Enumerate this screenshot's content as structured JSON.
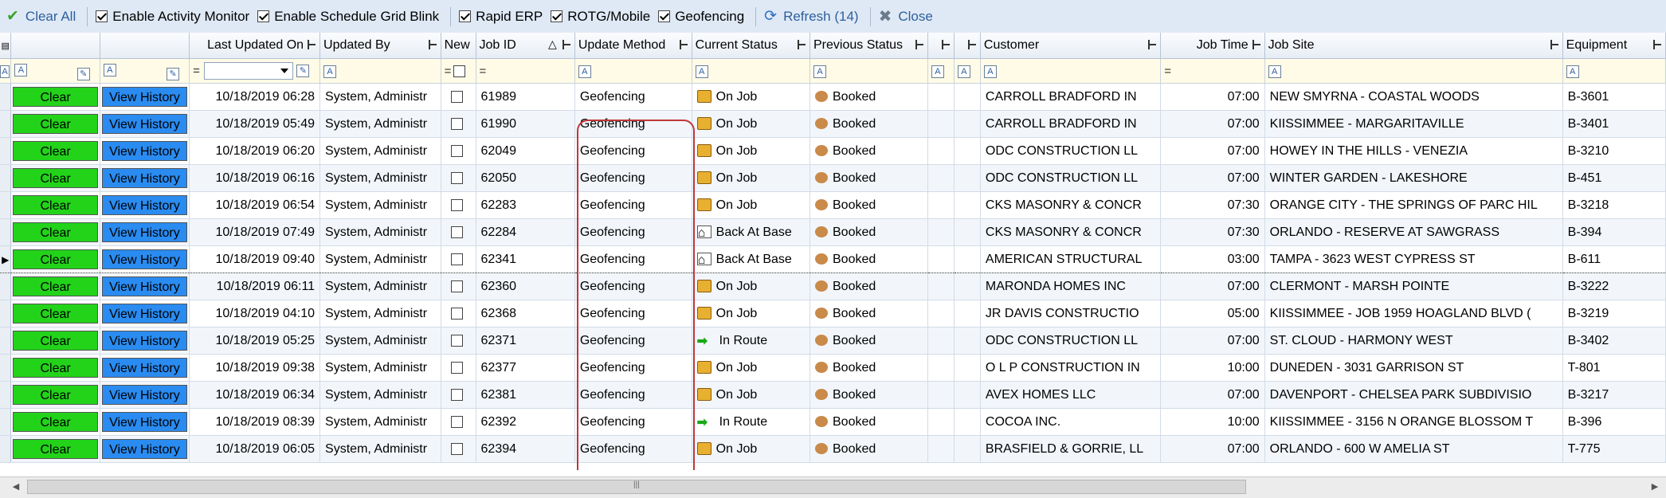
{
  "toolbar": {
    "clear_all": "Clear All",
    "enable_activity_monitor": "Enable Activity Monitor",
    "enable_schedule_grid_blink": "Enable Schedule Grid Blink",
    "rapid_erp": "Rapid ERP",
    "rotg_mobile": "ROTG/Mobile",
    "geofencing": "Geofencing",
    "refresh": "Refresh (14)",
    "close": "Close"
  },
  "columns": {
    "last_updated_on": "Last Updated On",
    "updated_by": "Updated By",
    "new": "New",
    "job_id": "Job ID",
    "update_method": "Update Method",
    "current_status": "Current Status",
    "previous_status": "Previous Status",
    "customer": "Customer",
    "job_time": "Job Time",
    "job_site": "Job Site",
    "equipment": "Equipment"
  },
  "filter": {
    "eq": "=",
    "icon": "A"
  },
  "labels": {
    "clear": "Clear",
    "view_history": "View History"
  },
  "colors": {
    "clear_button": "#22d31a",
    "history_button": "#2a8bf0",
    "highlight": "#c0373a"
  },
  "rows": [
    {
      "updated": "10/18/2019 06:28",
      "by": "System, Administr",
      "job": "61989",
      "method": "Geofencing",
      "status": "On Job",
      "prev": "Booked",
      "customer": "CARROLL BRADFORD IN",
      "time": "07:00",
      "site": "NEW SMYRNA - COASTAL WOODS",
      "equip": "B-3601"
    },
    {
      "updated": "10/18/2019 05:49",
      "by": "System, Administr",
      "job": "61990",
      "method": "Geofencing",
      "status": "On Job",
      "prev": "Booked",
      "customer": "CARROLL BRADFORD IN",
      "time": "07:00",
      "site": "KIISSIMMEE - MARGARITAVILLE",
      "equip": "B-3401"
    },
    {
      "updated": "10/18/2019 06:20",
      "by": "System, Administr",
      "job": "62049",
      "method": "Geofencing",
      "status": "On Job",
      "prev": "Booked",
      "customer": "ODC CONSTRUCTION LL",
      "time": "07:00",
      "site": "HOWEY IN THE HILLS - VENEZIA",
      "equip": "B-3210"
    },
    {
      "updated": "10/18/2019 06:16",
      "by": "System, Administr",
      "job": "62050",
      "method": "Geofencing",
      "status": "On Job",
      "prev": "Booked",
      "customer": "ODC CONSTRUCTION LL",
      "time": "07:00",
      "site": "WINTER GARDEN - LAKESHORE",
      "equip": "B-451"
    },
    {
      "updated": "10/18/2019 06:54",
      "by": "System, Administr",
      "job": "62283",
      "method": "Geofencing",
      "status": "On Job",
      "prev": "Booked",
      "customer": "CKS MASONRY & CONCR",
      "time": "07:30",
      "site": "ORANGE CITY - THE SPRINGS OF PARC HIL",
      "equip": "B-3218"
    },
    {
      "updated": "10/18/2019 07:49",
      "by": "System, Administr",
      "job": "62284",
      "method": "Geofencing",
      "status": "Back At Base",
      "prev": "Booked",
      "customer": "CKS MASONRY & CONCR",
      "time": "07:30",
      "site": "ORLANDO - RESERVE AT SAWGRASS",
      "equip": "B-394"
    },
    {
      "updated": "10/18/2019 09:40",
      "by": "System, Administr",
      "job": "62341",
      "method": "Geofencing",
      "status": "Back At Base",
      "prev": "Booked",
      "customer": "AMERICAN STRUCTURAL",
      "time": "03:00",
      "site": "TAMPA - 3623 WEST CYPRESS ST",
      "equip": "B-611"
    },
    {
      "updated": "10/18/2019 06:11",
      "by": "System, Administr",
      "job": "62360",
      "method": "Geofencing",
      "status": "On Job",
      "prev": "Booked",
      "customer": "MARONDA HOMES INC",
      "time": "07:00",
      "site": "CLERMONT - MARSH POINTE",
      "equip": "B-3222"
    },
    {
      "updated": "10/18/2019 04:10",
      "by": "System, Administr",
      "job": "62368",
      "method": "Geofencing",
      "status": "On Job",
      "prev": "Booked",
      "customer": "JR DAVIS CONSTRUCTIO",
      "time": "05:00",
      "site": "KIISSIMMEE - JOB 1959 HOAGLAND BLVD (",
      "equip": "B-3219"
    },
    {
      "updated": "10/18/2019 05:25",
      "by": "System, Administr",
      "job": "62371",
      "method": "Geofencing",
      "status": "In Route",
      "prev": "Booked",
      "customer": "ODC CONSTRUCTION LL",
      "time": "07:00",
      "site": "ST. CLOUD - HARMONY WEST",
      "equip": "B-3402"
    },
    {
      "updated": "10/18/2019 09:38",
      "by": "System, Administr",
      "job": "62377",
      "method": "Geofencing",
      "status": "On Job",
      "prev": "Booked",
      "customer": "O L P CONSTRUCTION IN",
      "time": "10:00",
      "site": "DUNEDEN - 3031 GARRISON ST",
      "equip": "T-801"
    },
    {
      "updated": "10/18/2019 06:34",
      "by": "System, Administr",
      "job": "62381",
      "method": "Geofencing",
      "status": "On Job",
      "prev": "Booked",
      "customer": "AVEX HOMES LLC",
      "time": "07:00",
      "site": "DAVENPORT - CHELSEA PARK SUBDIVISIO",
      "equip": "B-3217"
    },
    {
      "updated": "10/18/2019 08:39",
      "by": "System, Administr",
      "job": "62392",
      "method": "Geofencing",
      "status": "In Route",
      "prev": "Booked",
      "customer": "COCOA INC.",
      "time": "10:00",
      "site": "KIISSIMMEE - 3156 N ORANGE BLOSSOM T",
      "equip": "B-396"
    },
    {
      "updated": "10/18/2019 06:05",
      "by": "System, Administr",
      "job": "62394",
      "method": "Geofencing",
      "status": "On Job",
      "prev": "Booked",
      "customer": "BRASFIELD & GORRIE, LL",
      "time": "07:00",
      "site": "ORLANDO - 600 W AMELIA ST",
      "equip": "T-775"
    }
  ]
}
